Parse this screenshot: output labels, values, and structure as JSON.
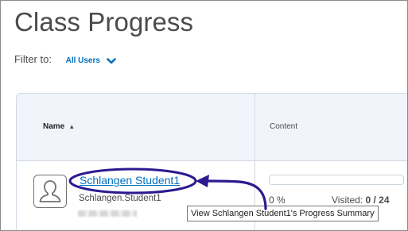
{
  "header": {
    "title": "Class Progress"
  },
  "filter": {
    "label": "Filter to:",
    "value": "All Users"
  },
  "table": {
    "columns": [
      {
        "label": "Name",
        "sort": "ascending"
      },
      {
        "label": "Content"
      }
    ],
    "rows": [
      {
        "name": "Schlangen Student1",
        "username": "Schlangen.Student1",
        "progress_percent_label": "0 %",
        "progress_fraction": 0,
        "visited_label": "Visited:",
        "visited_value": "0 / 24"
      }
    ]
  },
  "tooltip": {
    "text": "View Schlangen Student1's Progress Summary"
  },
  "colors": {
    "link": "#006fbf",
    "annotation": "#2b1a8f",
    "header_bg": "#f1f5fb"
  },
  "icons": {
    "avatar": "user-placeholder-icon",
    "filter_chevron": "chevron-down-icon",
    "sort": "sort-ascending-icon"
  }
}
